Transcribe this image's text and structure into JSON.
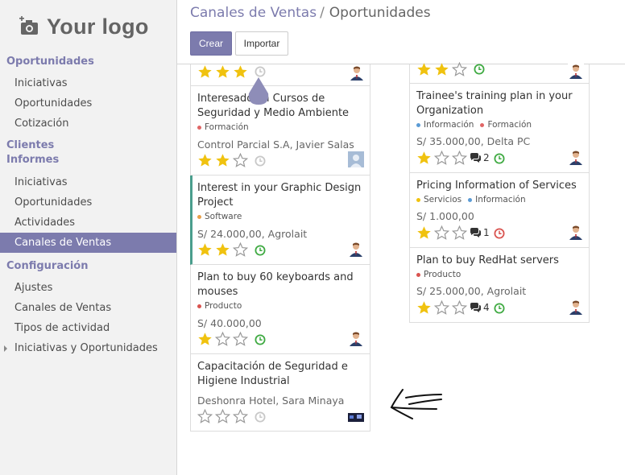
{
  "logo": {
    "text": "Your logo"
  },
  "sidebar": {
    "sections": [
      {
        "title": "Oportunidades",
        "items": [
          "Iniciativas",
          "Oportunidades",
          "Cotización"
        ]
      },
      {
        "title": "Clientes"
      },
      {
        "title": "Informes",
        "items": [
          "Iniciativas",
          "Oportunidades",
          "Actividades",
          "Canales de Ventas"
        ]
      },
      {
        "title": "Configuración",
        "items": [
          "Ajustes",
          "Canales de Ventas",
          "Tipos de actividad",
          "Iniciativas y Oportunidades"
        ]
      }
    ],
    "active_item": "Canales de Ventas"
  },
  "breadcrumb": {
    "parent": "Canales de Ventas",
    "separator": "/",
    "current": "Oportunidades"
  },
  "toolbar": {
    "create_label": "Crear",
    "import_label": "Importar"
  },
  "colors": {
    "accent": "#7c7bad",
    "star": "#f0c20f",
    "clock_green": "#3faa42",
    "clock_red": "#d9534f",
    "tag_formacion": "#e06666",
    "tag_informacion": "#5b9bd5",
    "tag_software": "#e8a04a",
    "tag_producto": "#d9534f",
    "tag_servicios": "#f0c20f"
  },
  "columns": {
    "left": {
      "cards": [
        {
          "stars": 3,
          "clock": "grey",
          "partial": true
        },
        {
          "title": "Interesado en Cursos de Seguridad y Medio Ambiente",
          "tags": [
            {
              "name": "Formación",
              "color": "#e06666"
            }
          ],
          "subtitle": "Control Parcial S.A, Javier Salas",
          "stars": 2,
          "clock": "grey"
        },
        {
          "title": "Interest in your Graphic Design Project",
          "tags": [
            {
              "name": "Software",
              "color": "#e8a04a"
            }
          ],
          "subtitle": "S/ 24.000,00, Agrolait",
          "stars": 2,
          "clock": "green",
          "accent": true
        },
        {
          "title": "Plan to buy 60 keyboards and mouses",
          "tags": [
            {
              "name": "Producto",
              "color": "#d9534f"
            }
          ],
          "subtitle": "S/ 40.000,00",
          "stars": 1,
          "clock": "green"
        },
        {
          "title": "Capacitación de Seguridad e Higiene Industrial",
          "subtitle": "Deshonra Hotel, Sara Minaya",
          "stars": 0,
          "clock": "grey"
        }
      ]
    },
    "right": {
      "cards": [
        {
          "stars": 2,
          "clock": "green",
          "partial": true
        },
        {
          "title": "Trainee's training plan in your Organization",
          "tags": [
            {
              "name": "Información",
              "color": "#5b9bd5"
            },
            {
              "name": "Formación",
              "color": "#e06666"
            }
          ],
          "subtitle": "S/ 35.000,00, Delta PC",
          "stars": 1,
          "messages": "2",
          "clock": "green"
        },
        {
          "title": "Pricing Information of Services",
          "tags": [
            {
              "name": "Servicios",
              "color": "#f0c20f"
            },
            {
              "name": "Información",
              "color": "#5b9bd5"
            }
          ],
          "subtitle": "S/ 1.000,00",
          "stars": 1,
          "messages": "1",
          "clock": "red"
        },
        {
          "title": "Plan to buy RedHat servers",
          "tags": [
            {
              "name": "Producto",
              "color": "#d9534f"
            }
          ],
          "subtitle": "S/ 25.000,00, Agrolait",
          "stars": 1,
          "messages": "4",
          "clock": "green"
        }
      ]
    }
  }
}
